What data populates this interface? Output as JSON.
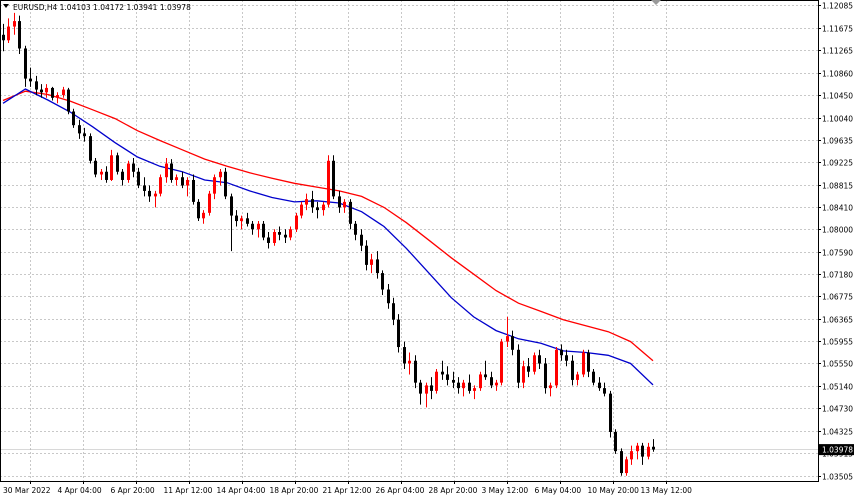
{
  "header": {
    "symbol_info": "EURUSD,H4  1.04103 1.04172 1.03941 1.03978"
  },
  "price_axis": {
    "labels": [
      "1.12085",
      "1.11675",
      "1.11265",
      "1.10860",
      "1.10450",
      "1.10040",
      "1.09635",
      "1.09225",
      "1.08815",
      "1.08410",
      "1.08000",
      "1.07590",
      "1.07180",
      "1.06775",
      "1.06365",
      "1.05955",
      "1.05550",
      "1.05140",
      "1.04730",
      "1.04325",
      "1.03915",
      "1.03505"
    ],
    "current_price": "1.03978"
  },
  "time_axis": {
    "labels": [
      "30 Mar 2022",
      "4 Apr 04:00",
      "6 Apr 20:00",
      "11 Apr 12:00",
      "14 Apr 04:00",
      "18 Apr 20:00",
      "21 Apr 12:00",
      "26 Apr 04:00",
      "28 Apr 20:00",
      "3 May 12:00",
      "6 May 04:00",
      "10 May 20:00",
      "13 May 12:00"
    ]
  },
  "colors": {
    "bull": "#ff0000",
    "bear": "#000000",
    "ma_fast": "#0000cc",
    "ma_slow": "#ff0000",
    "grid": "#c8c8c8",
    "background": "#ffffff"
  },
  "icons": [
    "dropdown-triangle-icon"
  ],
  "chart_data": {
    "type": "candlestick",
    "price_range": [
      1.03405,
      1.12185
    ],
    "candles": [
      [
        1.1155,
        1.1175,
        1.1125,
        1.1145
      ],
      [
        1.1145,
        1.1185,
        1.114,
        1.117
      ],
      [
        1.117,
        1.1195,
        1.1155,
        1.118
      ],
      [
        1.118,
        1.119,
        1.112,
        1.113
      ],
      [
        1.113,
        1.1135,
        1.106,
        1.1075
      ],
      [
        1.1075,
        1.1095,
        1.106,
        1.107
      ],
      [
        1.107,
        1.108,
        1.1045,
        1.1055
      ],
      [
        1.1055,
        1.1065,
        1.104,
        1.105
      ],
      [
        1.105,
        1.1065,
        1.104,
        1.1058
      ],
      [
        1.1058,
        1.106,
        1.1035,
        1.104
      ],
      [
        1.104,
        1.105,
        1.103,
        1.1045
      ],
      [
        1.1045,
        1.106,
        1.104,
        1.1055
      ],
      [
        1.1055,
        1.1058,
        1.101,
        1.1015
      ],
      [
        1.1015,
        1.102,
        1.0985,
        1.099
      ],
      [
        1.099,
        1.1,
        1.0965,
        1.0975
      ],
      [
        1.0975,
        1.0985,
        1.096,
        1.097
      ],
      [
        1.097,
        1.0975,
        1.092,
        1.0925
      ],
      [
        1.0925,
        1.093,
        1.0895,
        1.09
      ],
      [
        1.09,
        1.091,
        1.089,
        1.0905
      ],
      [
        1.0905,
        1.0915,
        1.0885,
        1.089
      ],
      [
        1.089,
        1.0945,
        1.0888,
        1.0935
      ],
      [
        1.0935,
        1.094,
        1.09,
        1.0905
      ],
      [
        1.0905,
        1.091,
        1.088,
        1.089
      ],
      [
        1.089,
        1.0925,
        1.0885,
        1.092
      ],
      [
        1.092,
        1.093,
        1.0895,
        1.0905
      ],
      [
        1.0905,
        1.0912,
        1.0875,
        1.088
      ],
      [
        1.088,
        1.0895,
        1.086,
        1.087
      ],
      [
        1.087,
        1.088,
        1.085,
        1.086
      ],
      [
        1.086,
        1.087,
        1.084,
        1.0865
      ],
      [
        1.0865,
        1.09,
        1.086,
        1.0895
      ],
      [
        1.0895,
        1.093,
        1.0885,
        1.092
      ],
      [
        1.092,
        1.0928,
        1.0885,
        1.089
      ],
      [
        1.089,
        1.09,
        1.088,
        1.0895
      ],
      [
        1.0895,
        1.0905,
        1.0875,
        1.088
      ],
      [
        1.088,
        1.0895,
        1.086,
        1.089
      ],
      [
        1.089,
        1.09,
        1.0845,
        1.085
      ],
      [
        1.085,
        1.0855,
        1.0815,
        1.082
      ],
      [
        1.082,
        1.0835,
        1.081,
        1.083
      ],
      [
        1.083,
        1.087,
        1.0825,
        1.0865
      ],
      [
        1.0865,
        1.09,
        1.0855,
        1.0895
      ],
      [
        1.0895,
        1.091,
        1.088,
        1.0905
      ],
      [
        1.0905,
        1.0912,
        1.0855,
        1.086
      ],
      [
        1.086,
        1.0865,
        1.076,
        1.0825
      ],
      [
        1.0825,
        1.0835,
        1.0805,
        1.0815
      ],
      [
        1.0815,
        1.0825,
        1.08,
        1.082
      ],
      [
        1.082,
        1.083,
        1.0805,
        1.081
      ],
      [
        1.081,
        1.0815,
        1.079,
        1.08
      ],
      [
        1.08,
        1.0815,
        1.0785,
        1.081
      ],
      [
        1.081,
        1.0815,
        1.078,
        1.0785
      ],
      [
        1.0785,
        1.0795,
        1.0765,
        1.0775
      ],
      [
        1.0775,
        1.08,
        1.077,
        1.0795
      ],
      [
        1.0795,
        1.0805,
        1.078,
        1.079
      ],
      [
        1.079,
        1.08,
        1.0775,
        1.0785
      ],
      [
        1.0785,
        1.0805,
        1.078,
        1.08
      ],
      [
        1.08,
        1.083,
        1.0795,
        1.0825
      ],
      [
        1.0825,
        1.085,
        1.082,
        1.0845
      ],
      [
        1.0845,
        1.0865,
        1.0835,
        1.0855
      ],
      [
        1.0855,
        1.087,
        1.083,
        1.084
      ],
      [
        1.084,
        1.085,
        1.082,
        1.0835
      ],
      [
        1.0835,
        1.085,
        1.0825,
        1.0845
      ],
      [
        1.0845,
        1.0935,
        1.084,
        1.0925
      ],
      [
        1.0925,
        1.0935,
        1.0855,
        1.086
      ],
      [
        1.086,
        1.087,
        1.083,
        1.084
      ],
      [
        1.084,
        1.0855,
        1.083,
        1.085
      ],
      [
        1.085,
        1.0855,
        1.08,
        1.081
      ],
      [
        1.081,
        1.0815,
        1.078,
        1.079
      ],
      [
        1.079,
        1.08,
        1.076,
        1.077
      ],
      [
        1.077,
        1.078,
        1.0725,
        1.0735
      ],
      [
        1.0735,
        1.0755,
        1.072,
        1.0745
      ],
      [
        1.0745,
        1.076,
        1.071,
        1.072
      ],
      [
        1.072,
        1.0725,
        1.068,
        1.069
      ],
      [
        1.069,
        1.07,
        1.0655,
        1.0665
      ],
      [
        1.0665,
        1.0675,
        1.0625,
        1.0635
      ],
      [
        1.0635,
        1.0645,
        1.0575,
        1.0585
      ],
      [
        1.0585,
        1.0595,
        1.0545,
        1.0555
      ],
      [
        1.0555,
        1.0575,
        1.0535,
        1.056
      ],
      [
        1.056,
        1.057,
        1.051,
        1.052
      ],
      [
        1.052,
        1.0525,
        1.048,
        1.05
      ],
      [
        1.05,
        1.052,
        1.0475,
        1.0515
      ],
      [
        1.0515,
        1.053,
        1.049,
        1.0505
      ],
      [
        1.0505,
        1.0545,
        1.05,
        1.054
      ],
      [
        1.054,
        1.056,
        1.0525,
        1.0535
      ],
      [
        1.0535,
        1.055,
        1.0515,
        1.0525
      ],
      [
        1.0525,
        1.054,
        1.051,
        1.052
      ],
      [
        1.052,
        1.053,
        1.05,
        1.051
      ],
      [
        1.051,
        1.0525,
        1.0495,
        1.052
      ],
      [
        1.052,
        1.0535,
        1.05,
        1.0505
      ],
      [
        1.0505,
        1.0515,
        1.049,
        1.051
      ],
      [
        1.051,
        1.054,
        1.0505,
        1.0535
      ],
      [
        1.0535,
        1.056,
        1.0525,
        1.053
      ],
      [
        1.053,
        1.054,
        1.051,
        1.0515
      ],
      [
        1.0515,
        1.0525,
        1.0505,
        1.052
      ],
      [
        1.052,
        1.06,
        1.0515,
        1.0595
      ],
      [
        1.0595,
        1.064,
        1.0585,
        1.0605
      ],
      [
        1.0605,
        1.0615,
        1.057,
        1.058
      ],
      [
        1.058,
        1.059,
        1.051,
        1.052
      ],
      [
        1.052,
        1.056,
        1.051,
        1.055
      ],
      [
        1.055,
        1.0565,
        1.053,
        1.054
      ],
      [
        1.054,
        1.0575,
        1.0535,
        1.057
      ],
      [
        1.057,
        1.058,
        1.0545,
        1.0555
      ],
      [
        1.0555,
        1.0565,
        1.05,
        1.051
      ],
      [
        1.051,
        1.052,
        1.0495,
        1.0515
      ],
      [
        1.0515,
        1.0585,
        1.051,
        1.058
      ],
      [
        1.058,
        1.059,
        1.056,
        1.057
      ],
      [
        1.057,
        1.058,
        1.055,
        1.056
      ],
      [
        1.056,
        1.057,
        1.0515,
        1.0525
      ],
      [
        1.0525,
        1.054,
        1.0515,
        1.0535
      ],
      [
        1.0535,
        1.058,
        1.053,
        1.0575
      ],
      [
        1.0575,
        1.058,
        1.053,
        1.054
      ],
      [
        1.054,
        1.0545,
        1.0515,
        1.052
      ],
      [
        1.052,
        1.053,
        1.0505,
        1.051
      ],
      [
        1.051,
        1.052,
        1.0495,
        1.05
      ],
      [
        1.05,
        1.0505,
        1.042,
        1.043
      ],
      [
        1.043,
        1.0435,
        1.039,
        1.0395
      ],
      [
        1.0395,
        1.04,
        1.035,
        1.0355
      ],
      [
        1.0355,
        1.0385,
        1.035,
        1.038
      ],
      [
        1.038,
        1.0405,
        1.037,
        1.0395
      ],
      [
        1.0395,
        1.041,
        1.038,
        1.0405
      ],
      [
        1.0405,
        1.041,
        1.037,
        1.0385
      ],
      [
        1.0385,
        1.041,
        1.038,
        1.0403
      ],
      [
        1.0403,
        1.0417,
        1.0394,
        1.0398
      ]
    ],
    "ma_fast": [
      1.103,
      1.1056,
      1.1036,
      1.1014,
      1.0987,
      1.0958,
      1.0932,
      1.0915,
      1.0905,
      1.089,
      1.0885,
      1.087,
      1.0858,
      1.085,
      1.0852,
      1.0848,
      1.0832,
      1.0805,
      1.0765,
      1.072,
      1.0675,
      1.064,
      1.0615,
      1.06,
      1.0592,
      1.0578,
      1.0575,
      1.057,
      1.0555,
      1.0516
    ],
    "ma_slow": [
      1.1035,
      1.1052,
      1.1046,
      1.1034,
      1.1018,
      1.1002,
      1.098,
      1.0962,
      1.0945,
      1.0928,
      1.0915,
      1.0903,
      1.0893,
      1.0884,
      1.0877,
      1.087,
      1.086,
      1.084,
      1.0812,
      1.078,
      1.0748,
      1.0718,
      1.0688,
      1.0665,
      1.065,
      1.0635,
      1.0624,
      1.0613,
      1.0595,
      1.056
    ]
  }
}
